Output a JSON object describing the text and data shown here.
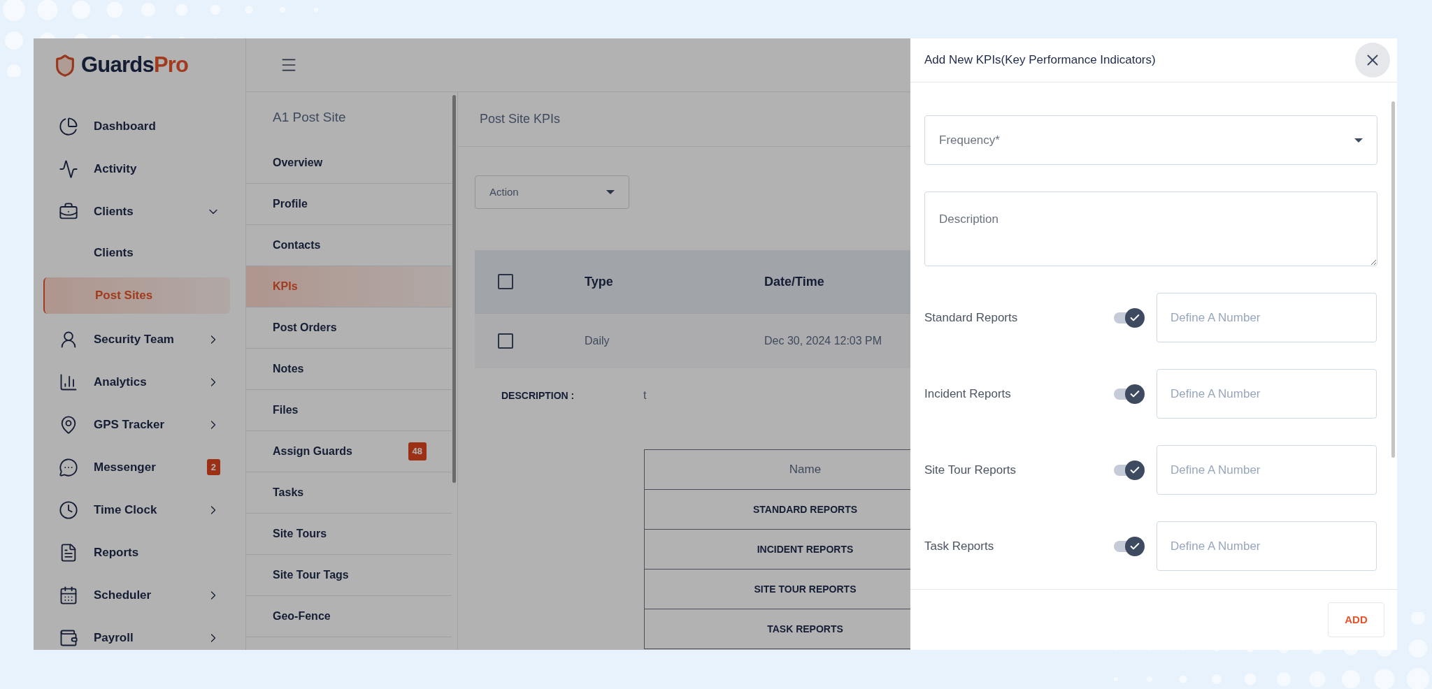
{
  "logo": {
    "brand": "Guards",
    "accent": "Pro"
  },
  "sidebar": {
    "items": [
      {
        "label": "Dashboard",
        "selected": false
      },
      {
        "label": "Activity",
        "selected": false
      },
      {
        "label": "Clients",
        "selected": false,
        "expanded": true,
        "children": [
          {
            "label": "Clients",
            "selected": false
          },
          {
            "label": "Post Sites",
            "selected": true
          }
        ]
      },
      {
        "label": "Security Team",
        "selected": false,
        "expanded": false
      },
      {
        "label": "Analytics",
        "selected": false,
        "expanded": false
      },
      {
        "label": "GPS Tracker",
        "selected": false,
        "expanded": false
      },
      {
        "label": "Messenger",
        "selected": false,
        "badge": "2"
      },
      {
        "label": "Time Clock",
        "selected": false,
        "expanded": false
      },
      {
        "label": "Reports",
        "selected": false
      },
      {
        "label": "Scheduler",
        "selected": false,
        "expanded": false
      },
      {
        "label": "Payroll",
        "selected": false,
        "expanded": false
      }
    ]
  },
  "site_menu": {
    "title": "A1 Post Site",
    "items": [
      {
        "label": "Overview",
        "selected": false
      },
      {
        "label": "Profile",
        "selected": false
      },
      {
        "label": "Contacts",
        "selected": false
      },
      {
        "label": "KPIs",
        "selected": true
      },
      {
        "label": "Post Orders",
        "selected": false
      },
      {
        "label": "Notes",
        "selected": false
      },
      {
        "label": "Files",
        "selected": false
      },
      {
        "label": "Assign Guards",
        "selected": false,
        "badge": "48"
      },
      {
        "label": "Tasks",
        "selected": false
      },
      {
        "label": "Site Tours",
        "selected": false
      },
      {
        "label": "Site Tour Tags",
        "selected": false
      },
      {
        "label": "Geo-Fence",
        "selected": false
      }
    ]
  },
  "main": {
    "title": "Post Site KPIs",
    "action_select": {
      "value": "Action"
    },
    "table": {
      "columns": [
        "Type",
        "Date/Time"
      ],
      "header_checked": false,
      "rows": [
        {
          "checked": false,
          "cells": [
            "Daily",
            "Dec 30, 2024 12:03 PM"
          ]
        }
      ]
    },
    "description": {
      "label": "DESCRIPTION :",
      "value": "t"
    },
    "kpi_table": {
      "columns": [
        "Name"
      ],
      "rows": [
        "STANDARD REPORTS",
        "INCIDENT REPORTS",
        "SITE TOUR REPORTS",
        "TASK REPORTS"
      ]
    }
  },
  "drawer": {
    "title": "Add New KPIs(Key Performance Indicators)",
    "frequency": {
      "placeholder": "Frequency*"
    },
    "description": {
      "placeholder": "Description"
    },
    "reports": [
      {
        "label": "Standard Reports",
        "on": true,
        "placeholder": "Define A Number"
      },
      {
        "label": "Incident Reports",
        "on": true,
        "placeholder": "Define A Number"
      },
      {
        "label": "Site Tour Reports",
        "on": true,
        "placeholder": "Define A Number"
      },
      {
        "label": "Task Reports",
        "on": true,
        "placeholder": "Define A Number"
      }
    ],
    "buttons": [
      "ADD"
    ]
  }
}
